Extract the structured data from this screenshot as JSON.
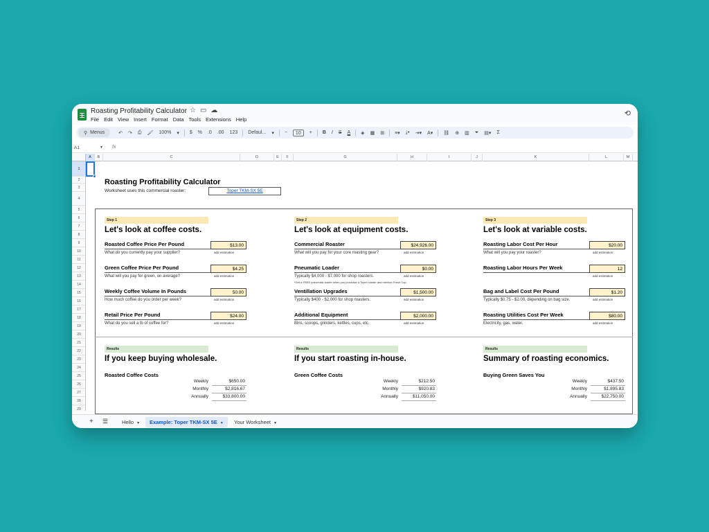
{
  "doc": {
    "title": "Roasting Profitability Calculator"
  },
  "menu": [
    "File",
    "Edit",
    "View",
    "Insert",
    "Format",
    "Data",
    "Tools",
    "Extensions",
    "Help"
  ],
  "toolbar": {
    "search": "Menus",
    "zoom": "100%",
    "currency": "$",
    "percent": "%",
    "decimals_less": ".0",
    "decimals_more": ".00",
    "number_format": "123",
    "font": "Defaul...",
    "font_size": "10"
  },
  "formula": {
    "cell_ref": "A1",
    "fx": "fx"
  },
  "columns": [
    "A",
    "B",
    "C",
    "D",
    "E",
    "F",
    "G",
    "H",
    "I",
    "J",
    "K",
    "L",
    "M"
  ],
  "rows": [
    "1",
    "2",
    "3",
    "4",
    "5",
    "6",
    "7",
    "8",
    "9",
    "10",
    "11",
    "12",
    "13",
    "14",
    "15",
    "16",
    "17",
    "18",
    "19",
    "20",
    "21",
    "22",
    "23",
    "24",
    "25",
    "26",
    "27",
    "28",
    "29"
  ],
  "sheet": {
    "title": "Roasting Profitability Calculator",
    "uses_text": "Worksheet uses this commercial roaster:",
    "roaster": "Toper TKM-SX 5E"
  },
  "est_label": "add estimation",
  "panels": [
    {
      "step": "Step 1",
      "heading": "Let's look at coffee costs.",
      "fields": [
        {
          "label": "Roasted Coffee Price Per Pound",
          "value": "$13.00",
          "hint": "What do you currently pay your supplier?",
          "note": ""
        },
        {
          "label": "Green Coffee Price Per Pound",
          "value": "$4.25",
          "hint": "What will you pay for green, on average?",
          "note": ""
        },
        {
          "label": "Weekly Coffee Volume In Pounds",
          "value": "50.00",
          "hint": "How much coffee do you order per week?",
          "note": ""
        },
        {
          "label": "Retail Price Per Pound",
          "value": "$24.00",
          "hint": "What do you sell a lb of coffee for?",
          "note": ""
        }
      ],
      "results_tag": "Results",
      "results_heading": "If you keep buying wholesale.",
      "result_label": "Roasted Coffee Costs",
      "results": [
        {
          "label": "Weekly",
          "value": "$650.00"
        },
        {
          "label": "Monthly",
          "value": "$2,816.67"
        },
        {
          "label": "Annually",
          "value": "$33,800.00"
        }
      ]
    },
    {
      "step": "Step 2",
      "heading": "Let's look at equipment costs.",
      "fields": [
        {
          "label": "Commercial Roaster",
          "value": "$24,926.00",
          "hint": "What will you pay for your core roasting gear?",
          "note": ""
        },
        {
          "label": "Pneumatic Loader",
          "value": "$0.00",
          "hint": "Typically $4,000 - $7,000 for shop roasters.",
          "note": "*Get a FREE pneumatic loader when you purchase a Toper roaster and mention Fresh Cup."
        },
        {
          "label": "Ventillation Upgrades",
          "value": "$1,500.00",
          "hint": "Typically $400 - $2,000 for shop roasters.",
          "note": ""
        },
        {
          "label": "Additional Equipment",
          "value": "$2,000.00",
          "hint": "Bins, scoops, grinders, kettles, cups, etc.",
          "note": ""
        }
      ],
      "results_tag": "Results",
      "results_heading": "If you start roasting in-house.",
      "result_label": "Green Coffee Costs",
      "results": [
        {
          "label": "Weekly",
          "value": "$212.50"
        },
        {
          "label": "Monthly",
          "value": "$920.83"
        },
        {
          "label": "Annually",
          "value": "$11,050.00"
        }
      ]
    },
    {
      "step": "Step 3",
      "heading": "Let's look at variable costs.",
      "fields": [
        {
          "label": "Roasting Labor Cost Per Hour",
          "value": "$20.00",
          "hint": "What will you pay your roaster?",
          "note": ""
        },
        {
          "label": "Roasting Labor Hours Per Week",
          "value": "12",
          "hint": "",
          "note": ""
        },
        {
          "label": "Bag and Label Cost Per Pound",
          "value": "$1.20",
          "hint": "Typically $0.75 - $2.00, depending on bag size.",
          "note": ""
        },
        {
          "label": "Roasting Utilities Cost Per Week",
          "value": "$80.00",
          "hint": "Electricity, gas, water.",
          "note": ""
        }
      ],
      "results_tag": "Results",
      "results_heading": "Summary of roasting economics.",
      "result_label": "Buying Green Saves You",
      "results": [
        {
          "label": "Weekly",
          "value": "$437.50"
        },
        {
          "label": "Monthly",
          "value": "$1,895.83"
        },
        {
          "label": "Annually",
          "value": "$22,750.00"
        }
      ]
    }
  ],
  "tabs": [
    {
      "label": "Hello",
      "active": false
    },
    {
      "label": "Example: Toper TKM-SX 5E",
      "active": true
    },
    {
      "label": "Your Worksheet",
      "active": false
    }
  ],
  "icons": {
    "title_icons": [
      "star-icon",
      "folder-icon",
      "cloud-icon"
    ],
    "history": "history-icon"
  }
}
